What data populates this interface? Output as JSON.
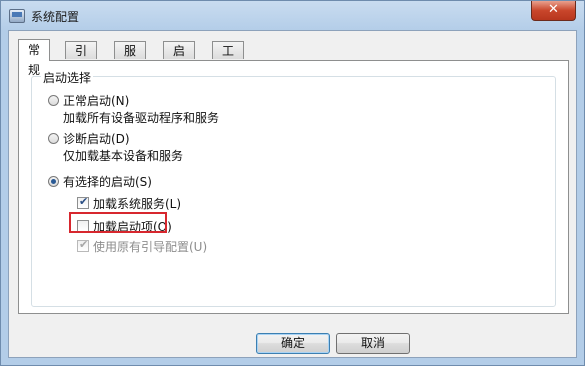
{
  "window": {
    "title": "系统配置",
    "close_glyph": "✕",
    "app_icon": "msconfig-icon"
  },
  "tabs": [
    {
      "label": "常规",
      "active": true
    },
    {
      "label": "引导",
      "active": false
    },
    {
      "label": "服务",
      "active": false
    },
    {
      "label": "启动",
      "active": false
    },
    {
      "label": "工具",
      "active": false
    }
  ],
  "general": {
    "group_title": "启动选择",
    "options": [
      {
        "label": "正常启动(N)",
        "description": "加载所有设备驱动程序和服务",
        "selected": false
      },
      {
        "label": "诊断启动(D)",
        "description": "仅加载基本设备和服务",
        "selected": false
      },
      {
        "label": "有选择的启动(S)",
        "selected": true
      }
    ],
    "selective": [
      {
        "label": "加载系统服务(L)",
        "checked": true,
        "enabled": true
      },
      {
        "label": "加载启动项(O)",
        "checked": false,
        "enabled": true,
        "highlighted": true
      },
      {
        "label": "使用原有引导配置(U)",
        "checked": true,
        "enabled": false
      }
    ]
  },
  "buttons": {
    "ok": "确定",
    "cancel": "取消"
  },
  "colors": {
    "highlight_border": "#d7272e",
    "radio_dot": "#2a5a95",
    "close_button": "#c9462b"
  }
}
